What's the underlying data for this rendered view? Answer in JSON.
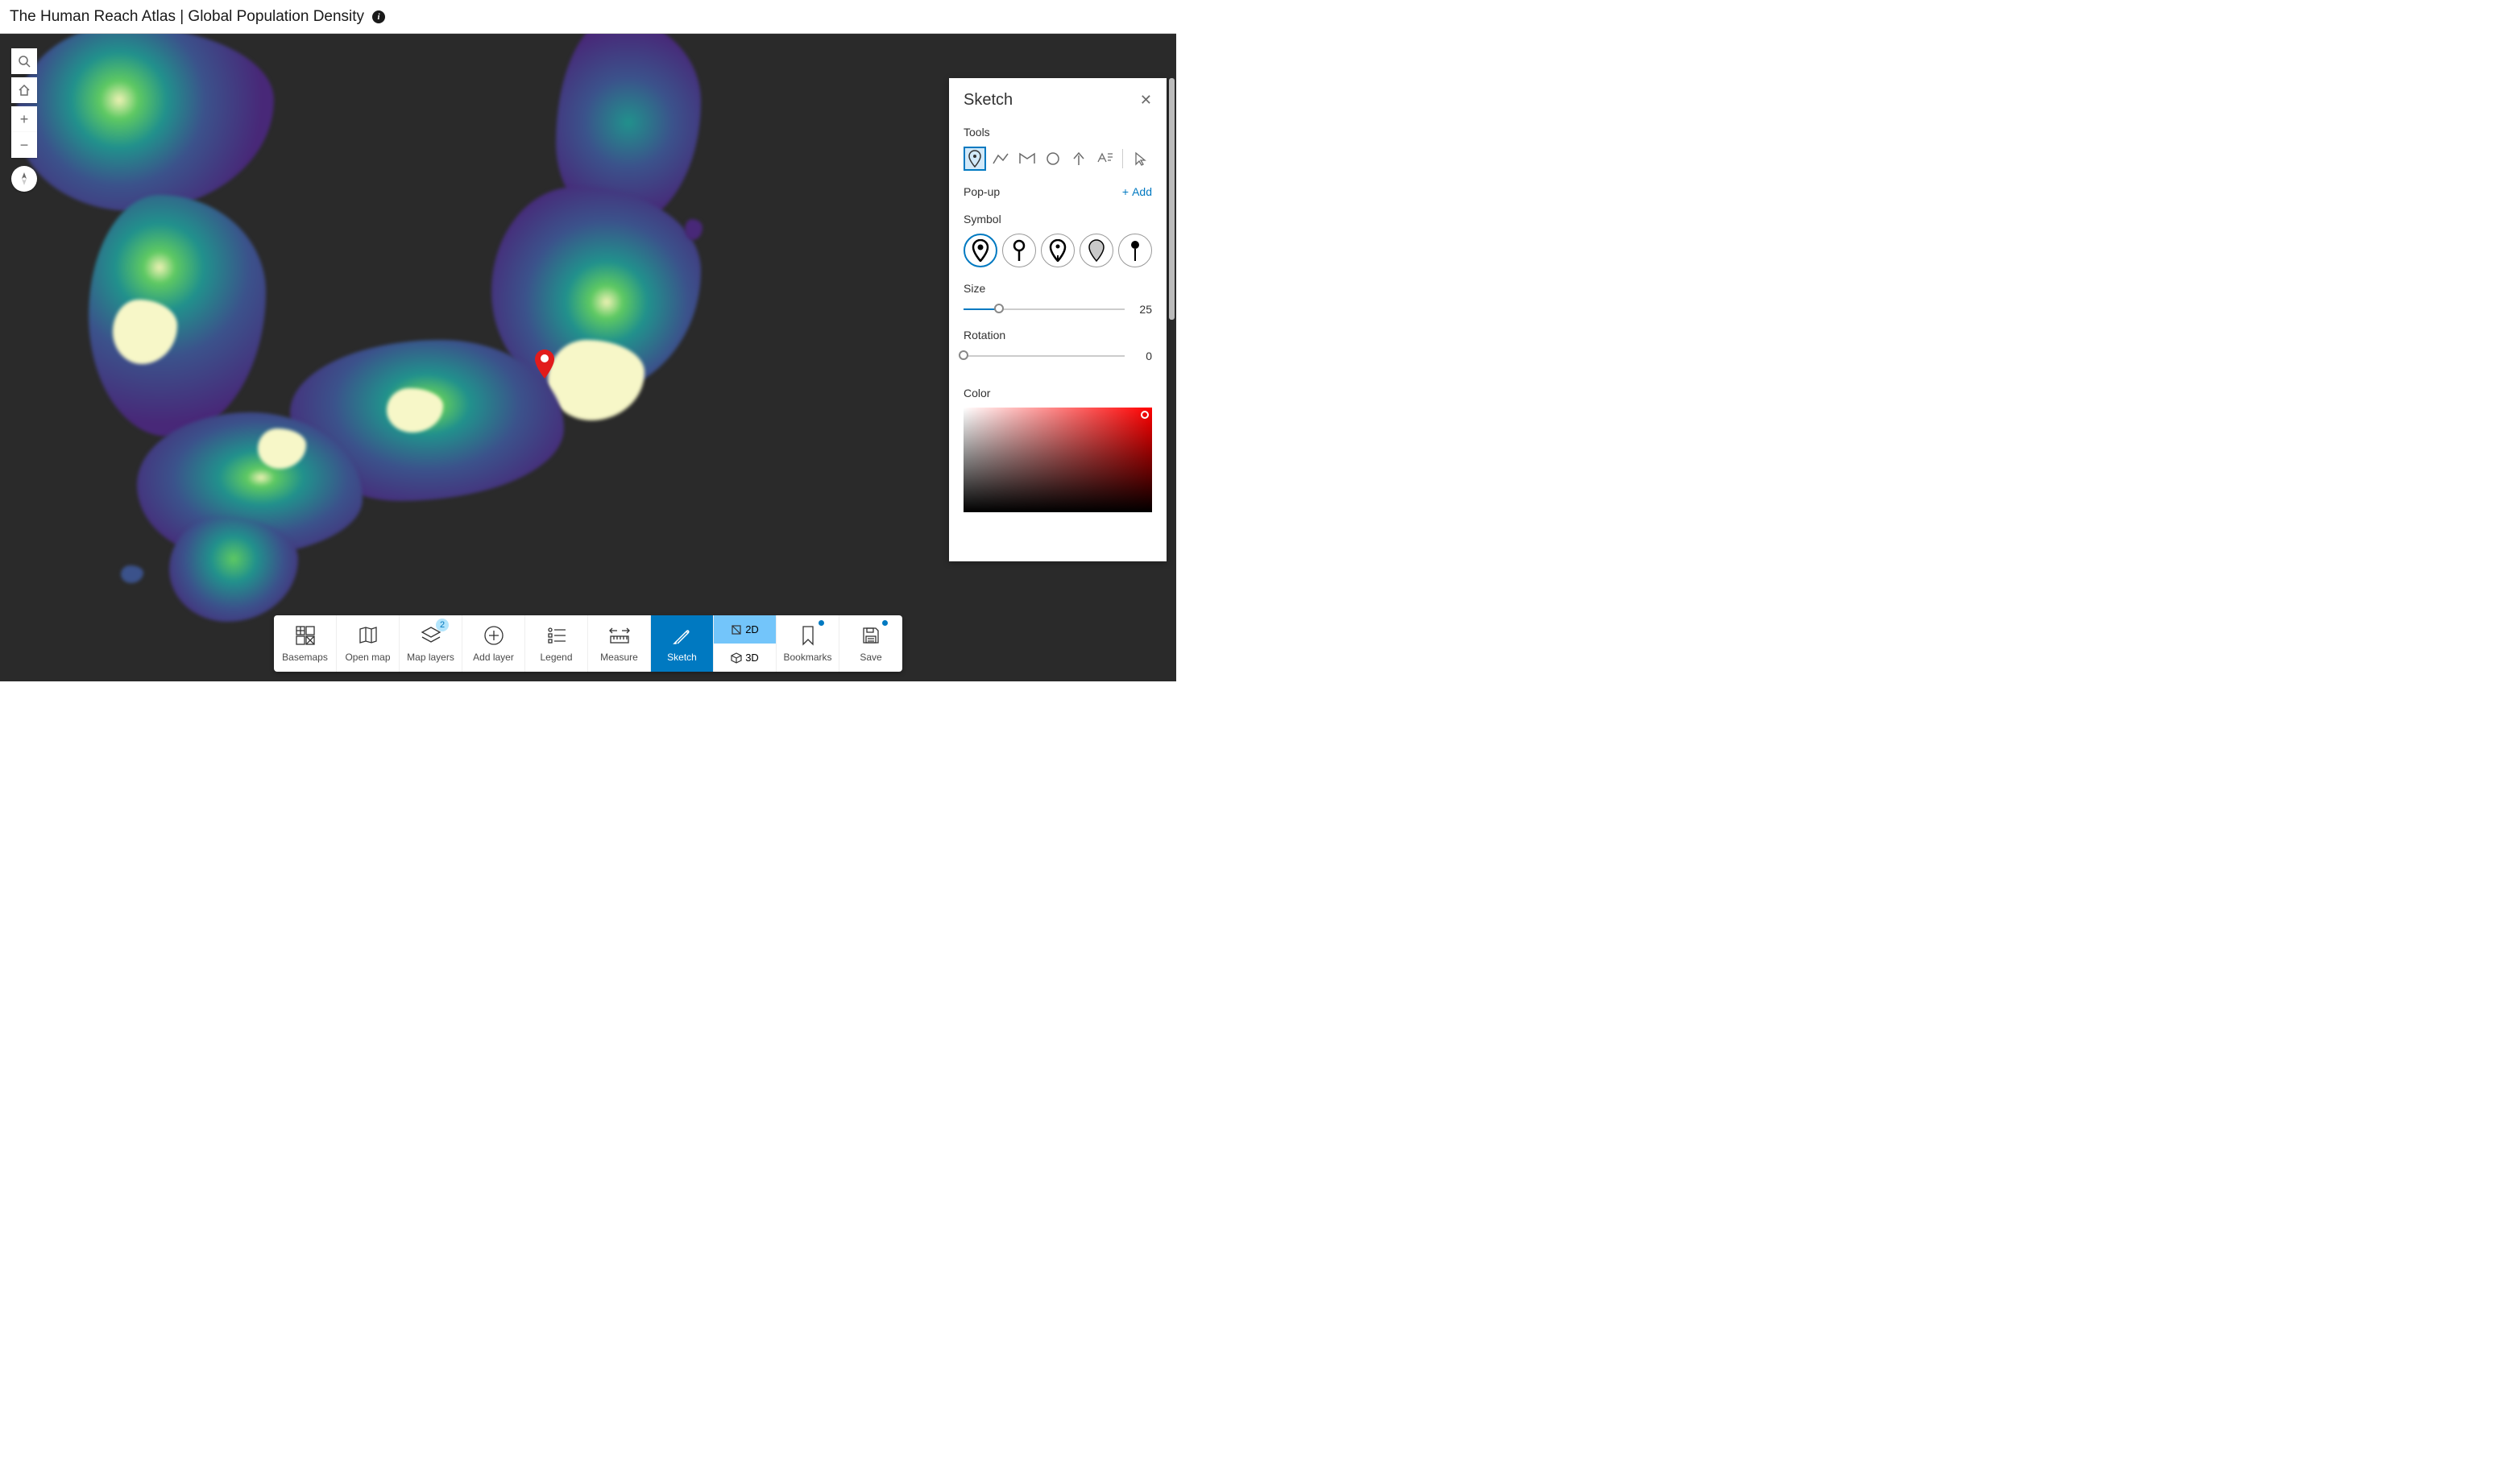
{
  "header": {
    "title": "The Human Reach Atlas | Global Population Density"
  },
  "map_controls": {
    "search": "search",
    "home": "home",
    "zoom_in": "+",
    "zoom_out": "−",
    "compass": "compass"
  },
  "marker": {
    "color": "#e21b1b"
  },
  "toolbar": {
    "items": [
      {
        "id": "basemaps",
        "label": "Basemaps"
      },
      {
        "id": "open_map",
        "label": "Open map"
      },
      {
        "id": "map_layers",
        "label": "Map layers",
        "badge": "2"
      },
      {
        "id": "add_layer",
        "label": "Add layer"
      },
      {
        "id": "legend",
        "label": "Legend"
      },
      {
        "id": "measure",
        "label": "Measure"
      },
      {
        "id": "sketch",
        "label": "Sketch",
        "active": true
      },
      {
        "id": "2d3d",
        "d2": "2D",
        "d3": "3D",
        "active": "2D"
      },
      {
        "id": "bookmarks",
        "label": "Bookmarks",
        "dot": true
      },
      {
        "id": "save",
        "label": "Save",
        "dot": true
      }
    ]
  },
  "sketch": {
    "title": "Sketch",
    "tools_label": "Tools",
    "tools": [
      "point",
      "line",
      "polygon",
      "circle",
      "arrow",
      "text",
      "select"
    ],
    "selected_tool": "point",
    "popup_label": "Pop-up",
    "add_label": "Add",
    "symbol_label": "Symbol",
    "selected_symbol": 0,
    "size_label": "Size",
    "size_value": "25",
    "size_percent": 22,
    "rotation_label": "Rotation",
    "rotation_value": "0",
    "rotation_percent": 0,
    "color_label": "Color"
  }
}
